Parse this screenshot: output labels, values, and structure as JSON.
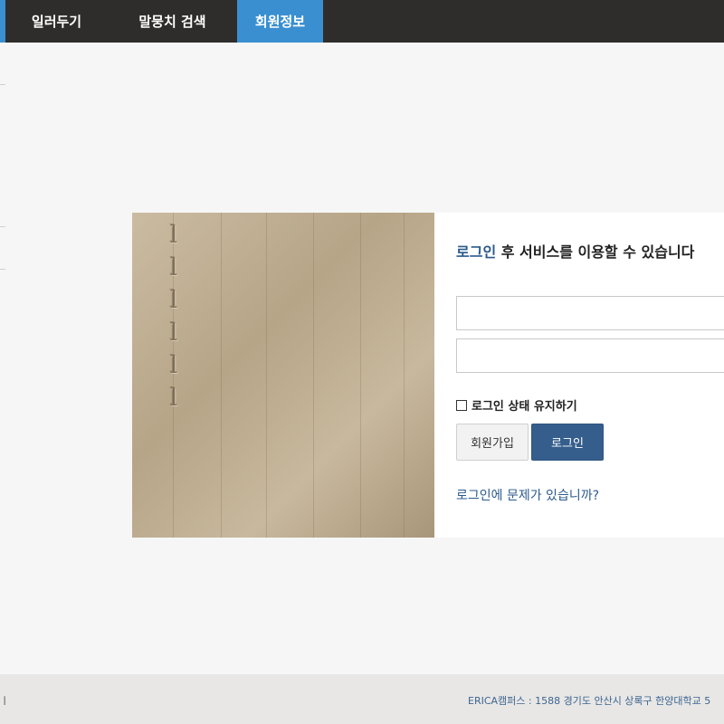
{
  "nav": {
    "items": [
      {
        "label": "일러두기"
      },
      {
        "label": "말뭉치 검색"
      },
      {
        "label": "회원정보"
      }
    ],
    "active_index": 2
  },
  "login": {
    "headline_highlight": "로그인",
    "headline_rest": " 후 서비스를 이용할 수 있습니다",
    "id_placeholder": "",
    "pw_placeholder": "",
    "remember_label": "로그인 상태 유지하기",
    "join_label": "회원가입",
    "login_label": "로그인",
    "help_link": "로그인에 문제가 있습니까?"
  },
  "footer": {
    "left_mark": "ㅣ",
    "campus": "ERICA캠퍼스 : 1588 경기도 안산시 상록구 한양대학교 5"
  },
  "colors": {
    "nav_bg": "#2f2d2c",
    "nav_active": "#3a8fd1",
    "login_button": "#355e8c",
    "link": "#2c5a8c"
  }
}
